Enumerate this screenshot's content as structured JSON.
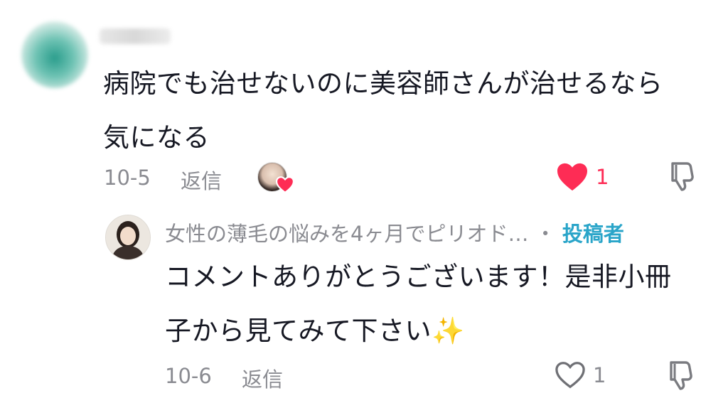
{
  "comment": {
    "text_line1": "病院でも治せないのに美容師さんが治せるなら",
    "text_line2": "気になる",
    "date": "10-5",
    "reply_label": "返信",
    "like_count": "1",
    "liked": true,
    "like_color": "#fe2c55"
  },
  "reply": {
    "author": "女性の薄毛の悩みを4ヶ月でピリオド…",
    "separator": "・",
    "badge": "投稿者",
    "text_line1": "コメントありがとうございます！是非小冊",
    "text_line2": "子から見てみて下さい",
    "emoji": "✨",
    "date": "10-6",
    "reply_label": "返信",
    "like_count": "1",
    "liked": false,
    "badge_color": "#2aa5c9"
  },
  "icons": [
    "heart-icon",
    "dislike-icon",
    "sparkles-icon"
  ]
}
